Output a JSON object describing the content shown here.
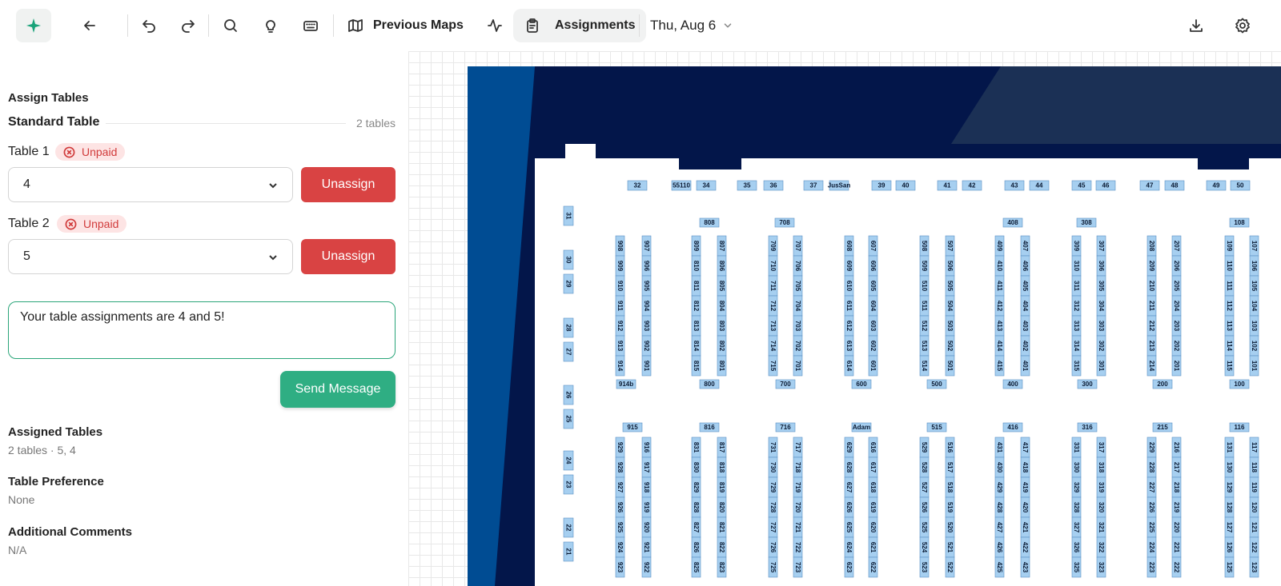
{
  "toolbar": {
    "previous_maps_label": "Previous Maps",
    "assignments_label": "Assignments",
    "date_label": "Thu, Aug 6"
  },
  "panel": {
    "heading": "Assign Tables",
    "table_type": "Standard Table",
    "table_count": "2 tables",
    "tables": [
      {
        "label": "Table 1",
        "status": "Unpaid",
        "value": "4",
        "action": "Unassign"
      },
      {
        "label": "Table 2",
        "status": "Unpaid",
        "value": "5",
        "action": "Unassign"
      }
    ],
    "message": "Your table assignments are 4 and 5!",
    "send_label": "Send Message",
    "assigned_title": "Assigned Tables",
    "assigned_value": "2 tables · 5, 4",
    "preference_title": "Table Preference",
    "preference_value": "None",
    "comments_title": "Additional Comments",
    "comments_value": "N/A"
  },
  "map": {
    "colors": {
      "venue_dark": "#03164a",
      "venue_blue": "#004c93",
      "venue_slate": "#1b3055",
      "table_fill": "#a6cff0",
      "table_stroke": "#5a8fc4"
    },
    "top_row": [
      "32",
      "55110",
      "34",
      "35",
      "36",
      "37",
      "JusSan",
      "39",
      "40",
      "41",
      "42",
      "43",
      "44",
      "45",
      "46",
      "47",
      "48",
      "49",
      "50"
    ],
    "side_col": [
      "31",
      "30",
      "29",
      "28",
      "27",
      "26",
      "25",
      "24",
      "23",
      "22",
      "21"
    ],
    "top_headers": [
      "808",
      "708",
      "408",
      "308",
      "108"
    ],
    "upper_cols": [
      [
        "908",
        "909",
        "910",
        "911",
        "912",
        "913",
        "914"
      ],
      [
        "907",
        "906",
        "905",
        "904",
        "903",
        "902",
        "901"
      ],
      [
        "809",
        "810",
        "811",
        "812",
        "813",
        "814",
        "815"
      ],
      [
        "807",
        "806",
        "805",
        "804",
        "803",
        "802",
        "801"
      ],
      [
        "709",
        "710",
        "711",
        "712",
        "713",
        "714",
        "715"
      ],
      [
        "707",
        "706",
        "705",
        "704",
        "703",
        "702",
        "701"
      ],
      [
        "608",
        "609",
        "610",
        "611",
        "612",
        "613",
        "614"
      ],
      [
        "607",
        "606",
        "605",
        "604",
        "603",
        "602",
        "601"
      ],
      [
        "508",
        "509",
        "510",
        "511",
        "512",
        "513",
        "514"
      ],
      [
        "507",
        "506",
        "505",
        "504",
        "503",
        "502",
        "501"
      ],
      [
        "409",
        "410",
        "411",
        "412",
        "413",
        "414",
        "415"
      ],
      [
        "407",
        "406",
        "405",
        "404",
        "403",
        "402",
        "401"
      ],
      [
        "309",
        "310",
        "311",
        "312",
        "313",
        "314",
        "315"
      ],
      [
        "307",
        "306",
        "305",
        "304",
        "303",
        "302",
        "301"
      ],
      [
        "208",
        "209",
        "210",
        "211",
        "212",
        "213",
        "214"
      ],
      [
        "207",
        "206",
        "205",
        "204",
        "203",
        "202",
        "201"
      ],
      [
        "109",
        "110",
        "111",
        "112",
        "113",
        "114",
        "115"
      ],
      [
        "107",
        "106",
        "105",
        "104",
        "103",
        "102",
        "101"
      ]
    ],
    "mid_headers": [
      "914b",
      "800",
      "700",
      "600",
      "500",
      "400",
      "300",
      "200",
      "100"
    ],
    "lower_headers": [
      "915",
      "816",
      "716",
      "Adam",
      "515",
      "416",
      "316",
      "215",
      "116"
    ],
    "lower_cols": [
      [
        "929",
        "928",
        "927",
        "926",
        "925",
        "924",
        "923"
      ],
      [
        "916",
        "917",
        "918",
        "919",
        "920",
        "921",
        "922"
      ],
      [
        "831",
        "830",
        "829",
        "828",
        "827",
        "826",
        "825"
      ],
      [
        "817",
        "818",
        "819",
        "820",
        "821",
        "822",
        "823"
      ],
      [
        "731",
        "730",
        "729",
        "728",
        "727",
        "726",
        "725"
      ],
      [
        "717",
        "718",
        "719",
        "720",
        "721",
        "722",
        "723"
      ],
      [
        "629",
        "628",
        "627",
        "626",
        "625",
        "624",
        "623"
      ],
      [
        "616",
        "617",
        "618",
        "619",
        "620",
        "621",
        "622"
      ],
      [
        "529",
        "528",
        "527",
        "526",
        "525",
        "524",
        "523"
      ],
      [
        "516",
        "517",
        "518",
        "519",
        "520",
        "521",
        "522"
      ],
      [
        "431",
        "430",
        "429",
        "428",
        "427",
        "426",
        "425"
      ],
      [
        "417",
        "418",
        "419",
        "420",
        "421",
        "422",
        "423"
      ],
      [
        "331",
        "330",
        "329",
        "328",
        "327",
        "326",
        "325"
      ],
      [
        "317",
        "318",
        "319",
        "320",
        "321",
        "322",
        "323"
      ],
      [
        "229",
        "228",
        "227",
        "226",
        "225",
        "224",
        "223"
      ],
      [
        "216",
        "217",
        "218",
        "219",
        "220",
        "221",
        "222"
      ],
      [
        "131",
        "130",
        "129",
        "128",
        "127",
        "126",
        "125"
      ],
      [
        "117",
        "118",
        "119",
        "120",
        "121",
        "122",
        "123"
      ]
    ]
  }
}
